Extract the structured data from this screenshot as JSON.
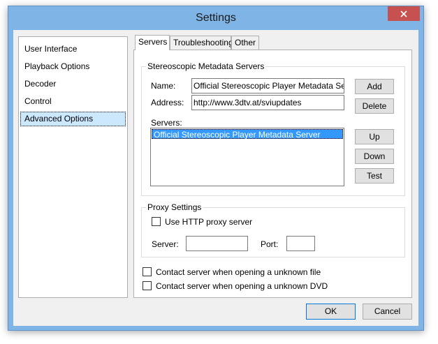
{
  "window": {
    "title": "Settings"
  },
  "nav": {
    "items": [
      {
        "label": "User Interface"
      },
      {
        "label": "Playback Options"
      },
      {
        "label": "Decoder"
      },
      {
        "label": "Control"
      },
      {
        "label": "Advanced Options",
        "selected": true
      }
    ]
  },
  "tabs": [
    {
      "label": "Servers",
      "active": true
    },
    {
      "label": "Troubleshooting"
    },
    {
      "label": "Other"
    }
  ],
  "servers_group": {
    "title": "Stereoscopic Metadata Servers",
    "name_label": "Name:",
    "name_value": "Official Stereoscopic Player Metadata Server",
    "address_label": "Address:",
    "address_value": "http://www.3dtv.at/sviupdates",
    "servers_label": "Servers:",
    "server_list": [
      "Official Stereoscopic Player Metadata Server"
    ],
    "add_label": "Add",
    "delete_label": "Delete",
    "up_label": "Up",
    "down_label": "Down",
    "test_label": "Test"
  },
  "proxy_group": {
    "title": "Proxy Settings",
    "use_proxy_label": "Use HTTP proxy server",
    "use_proxy_checked": false,
    "server_label": "Server:",
    "server_value": "",
    "port_label": "Port:",
    "port_value": ""
  },
  "options": {
    "contact_file_label": "Contact server when opening a unknown file",
    "contact_file_checked": false,
    "contact_dvd_label": "Contact server when opening a unknown DVD",
    "contact_dvd_checked": false
  },
  "footer": {
    "ok_label": "OK",
    "cancel_label": "Cancel"
  },
  "colors": {
    "title_bar": "#7fb4e6",
    "close_button": "#c75050",
    "selection": "#3399ff",
    "nav_selection": "#cce8ff"
  }
}
